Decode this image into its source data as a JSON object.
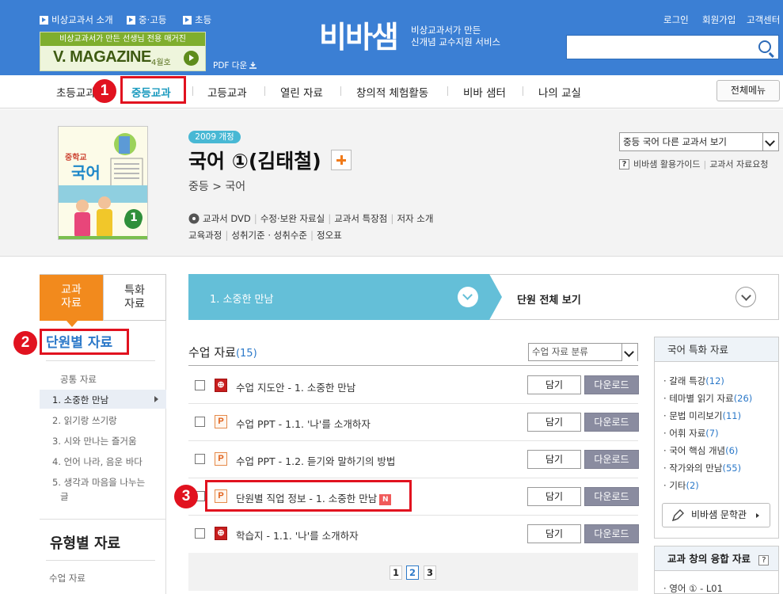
{
  "header": {
    "top_links": [
      "비상교과서 소개",
      "중·고등",
      "초등"
    ],
    "magazine_banner": {
      "caption": "비상교과서가 만든 선생님 전용 매거진",
      "title": "V. MAGAZINE",
      "issue": "4월호",
      "pdf_label": "PDF 다운"
    },
    "logo_text": "비바샘",
    "tagline_line1": "비상교과서가 만든",
    "tagline_line2": "신개념 교수지원 서비스",
    "user_links": [
      "로그인",
      "회원가입",
      "고객센터"
    ],
    "search_placeholder": ""
  },
  "nav": {
    "items": [
      "초등교과",
      "중등교과",
      "고등교과",
      "열린 자료",
      "창의적 체험활동",
      "비바 샘터",
      "나의 교실"
    ],
    "all_menu": "전체메뉴",
    "active_index": 1
  },
  "annotations": [
    "1",
    "2",
    "3"
  ],
  "book": {
    "revision_badge": "2009 개정",
    "title": "국어 ①(김태철)",
    "breadcrumb": "중등 > 국어",
    "cover_text": "중학교 국어",
    "cover_number": "1",
    "links_row1": [
      "교과서 DVD",
      "수정·보완 자료실",
      "교과서 특장점",
      "저자 소개"
    ],
    "links_row2": [
      "교육과정",
      "성취기준 · 성취수준",
      "정오표"
    ],
    "other_textbook_select": "중등 국어 다른 교과서 보기",
    "guide_q": "?",
    "guide_links": [
      "비바샘 활용가이드",
      "교과서 자료요청"
    ]
  },
  "sidebar": {
    "tab_textbook": [
      "교과",
      "자료"
    ],
    "tab_special": [
      "특화",
      "자료"
    ],
    "unit_heading": "단원별 자료",
    "items": [
      "공통 자료",
      "1. 소중한 만남",
      "2. 읽기랑 쓰기랑",
      "3. 시와 만나는 즐거움",
      "4. 언어 나라, 음운 바다",
      "5. 생각과 마음을 나누는",
      "글"
    ],
    "type_heading": "유형별 자료",
    "type_items": [
      "수업 자료"
    ]
  },
  "unit_bar": {
    "current_unit": "1. 소중한 만남",
    "view_all": "단원 전체 보기"
  },
  "materials": {
    "title": "수업 자료",
    "count": "(15)",
    "category_select": "수업 자료 분류",
    "save_label": "담기",
    "download_label": "다운로드",
    "new_badge": "N",
    "rows": [
      {
        "type": "pdf",
        "icon": "⊕",
        "title": "수업 지도안 - 1. 소중한 만남"
      },
      {
        "type": "ppt",
        "icon": "P",
        "title": "수업 PPT - 1.1. '나'를 소개하자"
      },
      {
        "type": "ppt",
        "icon": "P",
        "title": "수업 PPT - 1.2. 듣기와 말하기의 방법"
      },
      {
        "type": "ppt",
        "icon": "P",
        "title": "단원별 직업 정보 - 1. 소중한 만남"
      },
      {
        "type": "pdf",
        "icon": "⊕",
        "title": "학습지 - 1.1. '나'를 소개하자"
      }
    ],
    "pages": [
      "1",
      "2",
      "3"
    ],
    "current_page": "2"
  },
  "special_panel": {
    "heading": "국어 특화 자료",
    "items": [
      {
        "label": "갈래 특강",
        "count": "(12)"
      },
      {
        "label": "테마별 읽기 자료",
        "count": "(26)"
      },
      {
        "label": "문법 미리보기",
        "count": "(11)"
      },
      {
        "label": "어휘 자료",
        "count": "(7)"
      },
      {
        "label": "국어 핵심 개념",
        "count": "(6)"
      },
      {
        "label": "작가와의 만남",
        "count": "(55)"
      },
      {
        "label": "기타",
        "count": "(2)"
      }
    ],
    "literature_button": "비바샘 문학관"
  },
  "fusion_panel": {
    "heading": "교과 창의 융합 자료",
    "help": "?",
    "items": [
      "영어 ① - L01"
    ]
  },
  "colors": {
    "header_blue": "#3b7fd4",
    "accent_orange": "#f28a1d",
    "unit_bar_cyan": "#64bfd8",
    "link_blue": "#2c79c9",
    "annotation_red": "#e1121f"
  }
}
